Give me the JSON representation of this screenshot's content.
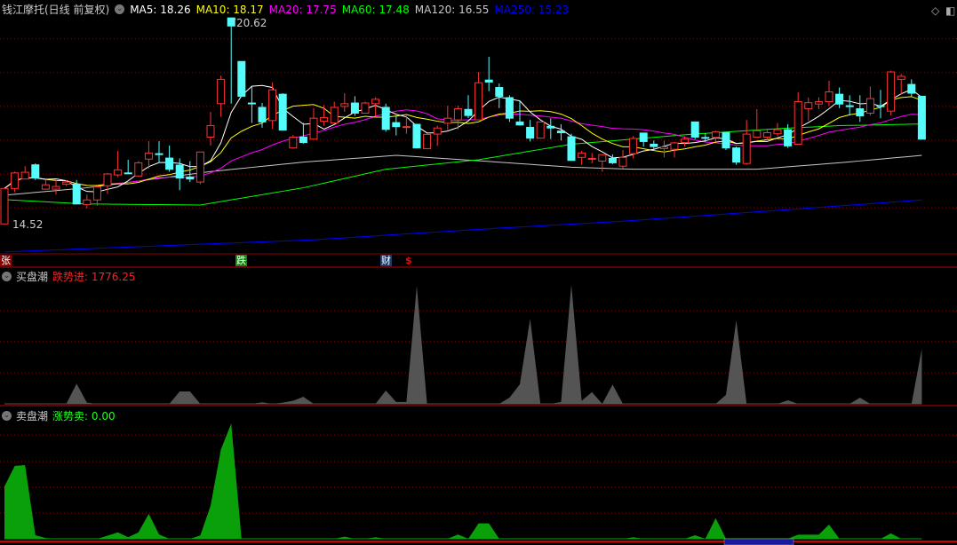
{
  "header": {
    "title": "钱江摩托(日线 前复权)",
    "ma": [
      {
        "label": "MA5: 18.26",
        "color": "#ffffff"
      },
      {
        "label": "MA10: 18.17",
        "color": "#ffff00"
      },
      {
        "label": "MA20: 17.75",
        "color": "#ff00ff"
      },
      {
        "label": "MA60: 17.48",
        "color": "#00ff00"
      },
      {
        "label": "MA120: 16.55",
        "color": "#c8c8c8"
      },
      {
        "label": "MA250: 15.23",
        "color": "#0000ff"
      }
    ]
  },
  "markers": {
    "zhang": "张",
    "die": "跌",
    "cai": "财",
    "dollar": "$"
  },
  "panel1": {
    "name": "买盘潮",
    "value_label": "跌势进: 1776.25"
  },
  "panel2": {
    "name": "卖盘潮",
    "value_label": "涨势卖: 0.00"
  },
  "chart_data": {
    "type": "candlestick",
    "ylim": [
      13.66,
      21.15
    ],
    "gridlines": [
      15,
      16,
      17,
      18,
      19,
      20
    ],
    "high_label": "20.62",
    "low_label": "14.52",
    "colors": {
      "up": "#ff3232",
      "down": "#54fcfc"
    },
    "ohlc": [
      [
        14.52,
        15.57,
        14.52,
        15.57
      ],
      [
        15.57,
        16.07,
        15.46,
        16.03
      ],
      [
        15.85,
        16.23,
        15.85,
        16.05
      ],
      [
        16.27,
        16.31,
        15.82,
        15.88
      ],
      [
        15.55,
        15.82,
        15.55,
        15.68
      ],
      [
        15.55,
        15.82,
        15.39,
        15.63
      ],
      [
        15.7,
        15.82,
        15.65,
        15.76
      ],
      [
        15.7,
        15.82,
        15.11,
        15.11
      ],
      [
        15.09,
        15.39,
        14.98,
        15.23
      ],
      [
        15.23,
        15.65,
        15.06,
        15.62
      ],
      [
        15.65,
        16.03,
        15.41,
        16.0
      ],
      [
        15.97,
        16.68,
        15.91,
        16.12
      ],
      [
        16.03,
        16.42,
        16.0,
        16.02
      ],
      [
        15.94,
        16.38,
        15.91,
        16.33
      ],
      [
        16.44,
        16.97,
        16.16,
        16.62
      ],
      [
        16.6,
        16.97,
        16.33,
        16.59
      ],
      [
        16.47,
        16.84,
        16.07,
        16.14
      ],
      [
        16.26,
        16.46,
        15.52,
        15.88
      ],
      [
        15.91,
        16.38,
        15.76,
        15.85
      ],
      [
        15.76,
        16.65,
        15.7,
        16.65
      ],
      [
        17.09,
        17.84,
        16.84,
        17.43
      ],
      [
        18.08,
        18.91,
        17.69,
        18.8
      ],
      [
        20.62,
        20.62,
        18.08,
        20.38
      ],
      [
        19.33,
        19.33,
        18.3,
        18.3
      ],
      [
        18.1,
        18.58,
        17.51,
        18.08
      ],
      [
        17.97,
        18.1,
        17.37,
        17.54
      ],
      [
        17.58,
        18.71,
        17.34,
        18.49
      ],
      [
        18.36,
        18.39,
        17.28,
        17.3
      ],
      [
        16.77,
        17.16,
        16.75,
        17.09
      ],
      [
        17.09,
        17.51,
        16.9,
        16.93
      ],
      [
        17.03,
        17.94,
        17.03,
        17.65
      ],
      [
        17.56,
        18.04,
        17.43,
        17.67
      ],
      [
        17.51,
        18.14,
        17.49,
        17.97
      ],
      [
        18.0,
        18.39,
        17.84,
        18.08
      ],
      [
        18.1,
        18.3,
        17.72,
        17.8
      ],
      [
        17.8,
        18.14,
        17.8,
        18.1
      ],
      [
        18.08,
        18.27,
        17.69,
        18.21
      ],
      [
        17.97,
        18.08,
        17.25,
        17.32
      ],
      [
        17.52,
        17.73,
        17.14,
        17.4
      ],
      [
        17.38,
        17.73,
        17.19,
        17.4
      ],
      [
        17.47,
        17.47,
        16.77,
        16.77
      ],
      [
        16.75,
        17.19,
        16.73,
        17.17
      ],
      [
        17.18,
        17.43,
        16.83,
        17.36
      ],
      [
        17.5,
        18.02,
        17.3,
        17.65
      ],
      [
        17.6,
        18.02,
        17.32,
        17.93
      ],
      [
        17.91,
        18.33,
        17.65,
        17.73
      ],
      [
        17.6,
        19.02,
        17.6,
        18.7
      ],
      [
        18.78,
        19.47,
        18.45,
        18.72
      ],
      [
        18.56,
        18.68,
        17.95,
        18.3
      ],
      [
        18.26,
        18.33,
        17.54,
        17.65
      ],
      [
        17.54,
        18.17,
        17.43,
        17.45
      ],
      [
        17.38,
        17.6,
        16.96,
        17.06
      ],
      [
        17.06,
        17.54,
        17.06,
        17.54
      ],
      [
        17.41,
        17.65,
        17.03,
        17.36
      ],
      [
        17.27,
        17.47,
        16.99,
        17.22
      ],
      [
        17.1,
        17.19,
        16.4,
        16.4
      ],
      [
        16.49,
        16.68,
        16.27,
        16.62
      ],
      [
        16.46,
        16.62,
        16.31,
        16.46
      ],
      [
        16.38,
        16.57,
        16.07,
        16.57
      ],
      [
        16.46,
        16.58,
        16.29,
        16.33
      ],
      [
        16.23,
        16.71,
        16.16,
        16.49
      ],
      [
        16.6,
        17.12,
        16.46,
        17.05
      ],
      [
        17.21,
        17.21,
        16.81,
        16.96
      ],
      [
        16.88,
        16.99,
        16.71,
        16.81
      ],
      [
        16.75,
        16.99,
        16.49,
        16.8
      ],
      [
        16.73,
        16.95,
        16.49,
        16.92
      ],
      [
        16.93,
        17.12,
        16.81,
        17.03
      ],
      [
        17.54,
        17.54,
        17.03,
        17.09
      ],
      [
        17.08,
        17.21,
        16.95,
        17.06
      ],
      [
        17.08,
        17.28,
        16.95,
        17.25
      ],
      [
        17.23,
        17.23,
        16.71,
        16.77
      ],
      [
        16.77,
        16.81,
        16.27,
        16.35
      ],
      [
        16.31,
        17.6,
        16.27,
        17.18
      ],
      [
        17.09,
        17.92,
        17.09,
        17.28
      ],
      [
        17.09,
        17.3,
        16.99,
        17.22
      ],
      [
        17.19,
        17.51,
        17.12,
        17.31
      ],
      [
        17.31,
        17.47,
        16.77,
        16.83
      ],
      [
        16.88,
        18.42,
        16.86,
        18.14
      ],
      [
        17.93,
        18.26,
        17.58,
        18.11
      ],
      [
        18.07,
        18.27,
        17.92,
        18.14
      ],
      [
        18.14,
        18.76,
        18.02,
        18.43
      ],
      [
        18.36,
        18.56,
        17.95,
        18.07
      ],
      [
        18.02,
        18.33,
        17.73,
        18.01
      ],
      [
        17.93,
        18.33,
        17.54,
        17.72
      ],
      [
        17.8,
        18.59,
        17.73,
        18.23
      ],
      [
        18.02,
        18.49,
        17.65,
        18.0
      ],
      [
        17.86,
        19.06,
        17.73,
        19.02
      ],
      [
        18.8,
        18.96,
        18.36,
        18.89
      ],
      [
        18.65,
        18.8,
        18.27,
        18.39
      ],
      [
        18.3,
        18.3,
        17.03,
        17.03
      ]
    ],
    "ma_long": {
      "ma60": [
        [
          0,
          15.24
        ],
        [
          8,
          15.11
        ],
        [
          19,
          15.08
        ],
        [
          29,
          15.59
        ],
        [
          37,
          16.14
        ],
        [
          46,
          16.42
        ],
        [
          55,
          16.88
        ],
        [
          66,
          17.16
        ],
        [
          75,
          17.34
        ],
        [
          81,
          17.43
        ],
        [
          89,
          17.48
        ]
      ],
      "ma120": [
        [
          0,
          15.37
        ],
        [
          8,
          15.59
        ],
        [
          20,
          16.07
        ],
        [
          29,
          16.35
        ],
        [
          38,
          16.55
        ],
        [
          46,
          16.39
        ],
        [
          55,
          16.2
        ],
        [
          61,
          16.14
        ],
        [
          73,
          16.14
        ],
        [
          81,
          16.33
        ],
        [
          89,
          16.55
        ]
      ],
      "ma250": [
        [
          0,
          13.69
        ],
        [
          30,
          14.05
        ],
        [
          46,
          14.36
        ],
        [
          60,
          14.6
        ],
        [
          75,
          14.92
        ],
        [
          89,
          15.23
        ]
      ]
    },
    "panel1_values": {
      "type": "area",
      "color": "#545454",
      "points": [
        [
          6,
          0
        ],
        [
          7,
          650
        ],
        [
          8,
          40
        ],
        [
          9,
          0
        ],
        [
          16,
          0
        ],
        [
          17,
          400
        ],
        [
          18,
          400
        ],
        [
          19,
          0
        ],
        [
          24,
          0
        ],
        [
          25,
          50
        ],
        [
          26,
          0
        ],
        [
          27,
          40
        ],
        [
          28,
          100
        ],
        [
          29,
          230
        ],
        [
          30,
          0
        ],
        [
          36,
          0
        ],
        [
          37,
          430
        ],
        [
          38,
          60
        ],
        [
          39,
          60
        ],
        [
          40,
          3800
        ],
        [
          41,
          0
        ],
        [
          48,
          0
        ],
        [
          49,
          200
        ],
        [
          50,
          630
        ],
        [
          51,
          2740
        ],
        [
          52,
          0
        ],
        [
          53,
          0
        ],
        [
          54,
          60
        ],
        [
          55,
          3840
        ],
        [
          56,
          100
        ],
        [
          57,
          380
        ],
        [
          58,
          0
        ],
        [
          59,
          620
        ],
        [
          60,
          0
        ],
        [
          69,
          0
        ],
        [
          70,
          290
        ],
        [
          71,
          2690
        ],
        [
          72,
          0
        ],
        [
          75,
          0
        ],
        [
          76,
          115
        ],
        [
          77,
          0
        ],
        [
          82,
          0
        ],
        [
          83,
          200
        ],
        [
          84,
          0
        ],
        [
          88,
          0
        ],
        [
          89,
          1776.25
        ]
      ]
    },
    "panel2_values": {
      "type": "area",
      "color": "#0aa00a",
      "points": [
        [
          0,
          2030
        ],
        [
          1,
          2830
        ],
        [
          2,
          2860
        ],
        [
          3,
          140
        ],
        [
          4,
          30
        ],
        [
          5,
          0
        ],
        [
          9,
          0
        ],
        [
          10,
          120
        ],
        [
          11,
          250
        ],
        [
          12,
          60
        ],
        [
          13,
          250
        ],
        [
          14,
          970
        ],
        [
          15,
          170
        ],
        [
          16,
          0
        ],
        [
          18,
          0
        ],
        [
          19,
          130
        ],
        [
          20,
          1290
        ],
        [
          21,
          3470
        ],
        [
          22,
          4480
        ],
        [
          23,
          0
        ],
        [
          32,
          0
        ],
        [
          33,
          80
        ],
        [
          34,
          0
        ],
        [
          35,
          0
        ],
        [
          36,
          60
        ],
        [
          37,
          0
        ],
        [
          43,
          0
        ],
        [
          44,
          170
        ],
        [
          45,
          0
        ],
        [
          46,
          600
        ],
        [
          47,
          600
        ],
        [
          48,
          0
        ],
        [
          60,
          0
        ],
        [
          61,
          60
        ],
        [
          62,
          0
        ],
        [
          66,
          0
        ],
        [
          67,
          140
        ],
        [
          68,
          0
        ],
        [
          69,
          800
        ],
        [
          70,
          0
        ],
        [
          76,
          0
        ],
        [
          77,
          160
        ],
        [
          78,
          160
        ],
        [
          79,
          160
        ],
        [
          80,
          550
        ],
        [
          81,
          0
        ],
        [
          85,
          0
        ],
        [
          86,
          210
        ],
        [
          87,
          0
        ],
        [
          89,
          0
        ]
      ]
    }
  }
}
